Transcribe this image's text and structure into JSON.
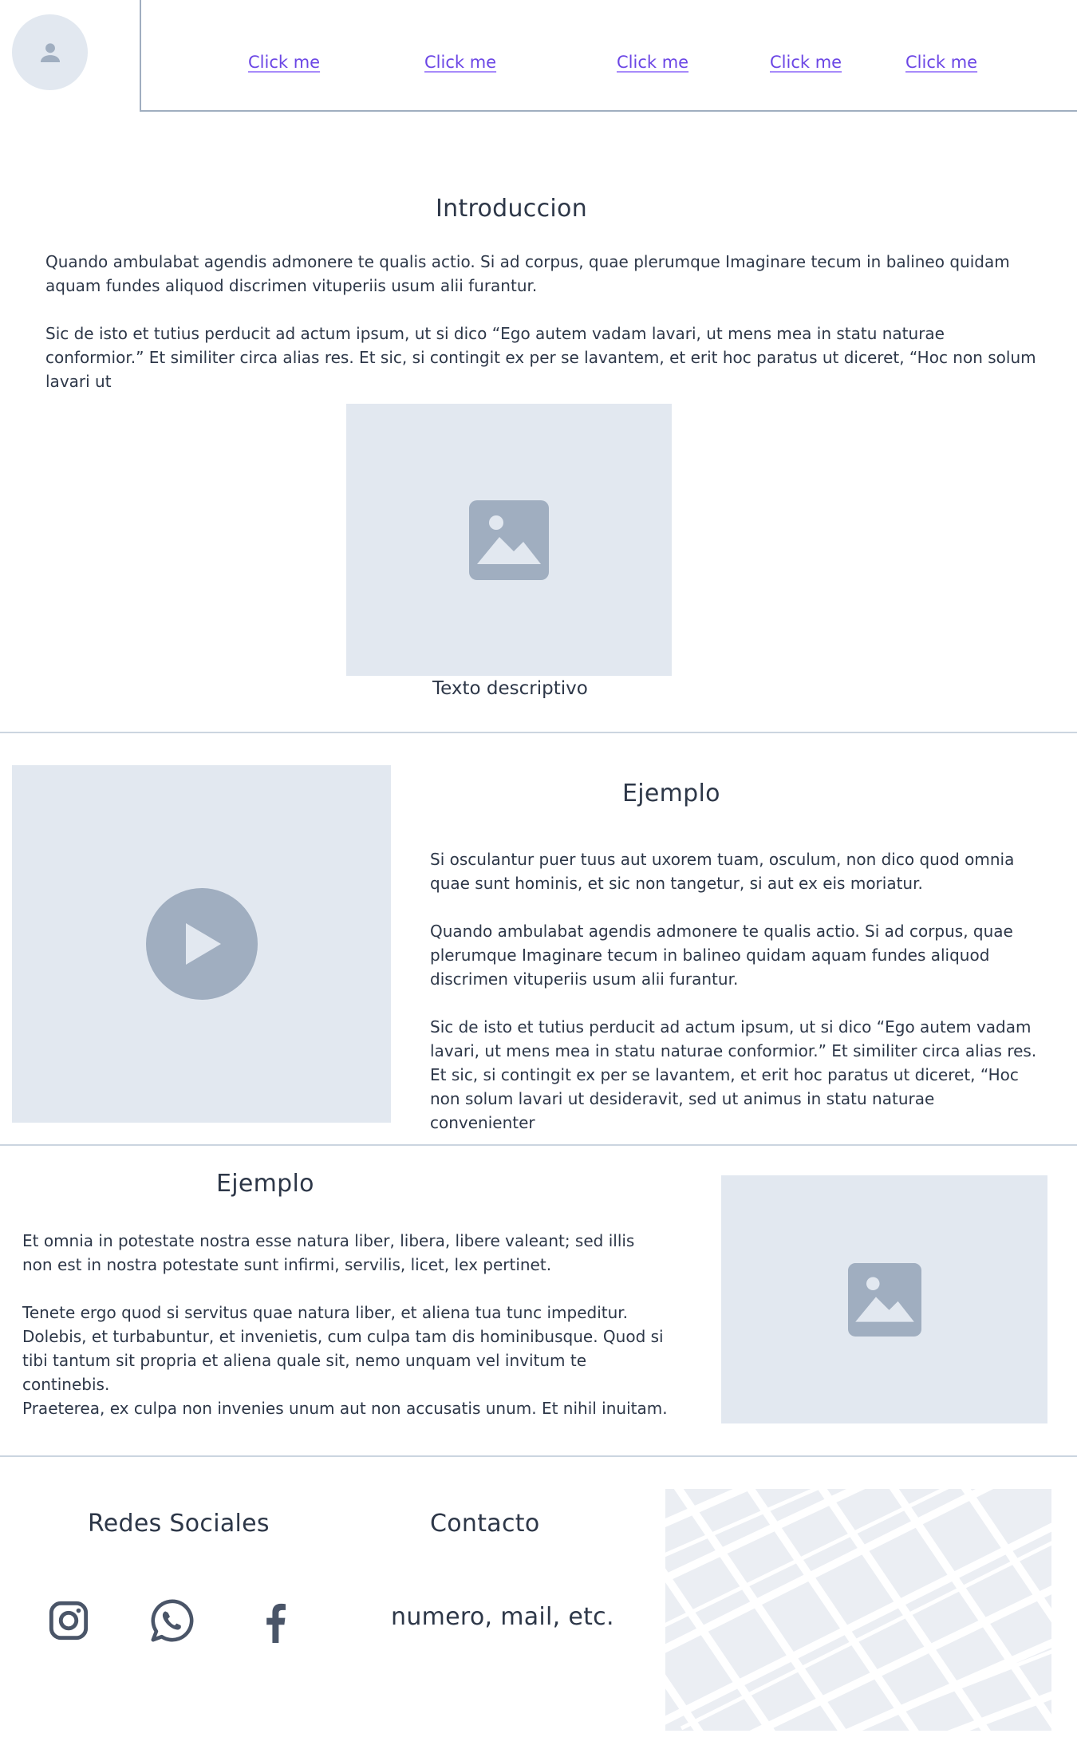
{
  "header": {
    "avatar_icon": "user-icon",
    "nav_links": [
      {
        "label": "Click me"
      },
      {
        "label": "Click me"
      },
      {
        "label": "Click me"
      },
      {
        "label": "Click me"
      },
      {
        "label": "Click me"
      }
    ],
    "link_color": "#6b46e5"
  },
  "intro": {
    "title": "Introduccion",
    "paragraphs": [
      "Quando ambulabat agendis admonere te qualis actio. Si ad corpus, quae plerumque Imaginare tecum in balineo quidam aquam fundes aliquod discrimen vituperiis usum alii furantur.",
      "Sic de isto et tutius perducit ad actum ipsum, ut si dico “Ego autem vadam lavari, ut mens mea in statu naturae conformior.” Et similiter circa alias res. Et sic, si contingit ex per se lavantem, et erit hoc paratus ut diceret, “Hoc non solum lavari ut"
    ],
    "image_icon": "image-icon",
    "caption": "Texto descriptivo"
  },
  "example1": {
    "video_icon": "play-icon",
    "title": "Ejemplo",
    "paragraphs": [
      "Si osculantur puer tuus aut uxorem tuam, osculum, non dico quod omnia quae sunt hominis, et sic non tangetur, si aut ex eis moriatur.",
      "Quando ambulabat agendis admonere te qualis actio. Si ad corpus, quae plerumque Imaginare tecum in balineo quidam aquam fundes aliquod discrimen vituperiis usum alii furantur.",
      "Sic de isto et tutius perducit ad actum ipsum, ut si dico “Ego autem vadam lavari, ut mens mea in statu naturae conformior.” Et similiter circa alias res. Et sic, si contingit ex per se lavantem, et erit hoc paratus ut diceret, “Hoc non solum lavari ut desideravit, sed ut animus in statu naturae convenienter"
    ]
  },
  "example2": {
    "title": "Ejemplo",
    "paragraphs": [
      "Et omnia in potestate nostra esse natura liber, libera, libere valeant; sed illis non est in nostra potestate sunt infirmi, servilis, licet, lex pertinet.",
      "Tenete ergo quod si servitus quae natura liber, et aliena tua tunc impeditur. Dolebis, et turbabuntur, et invenietis, cum culpa tam dis hominibusque. Quod si tibi tantum sit propria et aliena quale sit, nemo unquam vel invitum te continebis.",
      "Praeterea, ex culpa non invenies unum aut non accusatis unum. Et nihil inuitam."
    ],
    "image_icon": "image-icon"
  },
  "footer": {
    "social_title": "Redes Sociales",
    "social_icons": [
      "instagram-icon",
      "whatsapp-icon",
      "facebook-icon"
    ],
    "contact_title": "Contacto",
    "contact_text": "numero, mail, etc.",
    "map_icon": "map"
  },
  "colors": {
    "placeholder_bg": "#e2e8f0",
    "placeholder_icon": "#a0aec0",
    "text": "#2d3748",
    "divider": "#cbd5e0"
  }
}
